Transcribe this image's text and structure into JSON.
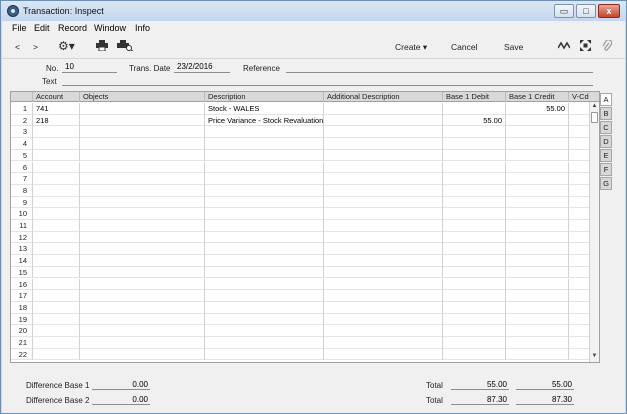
{
  "window": {
    "title": "Transaction: Inspect",
    "controls": {
      "minimize": "▭",
      "maximize": "□",
      "close": "x"
    }
  },
  "menu": [
    "File",
    "Edit",
    "Record",
    "Window",
    "Info"
  ],
  "toolbar": {
    "back": "<",
    "forward": ">",
    "create_label": "Create",
    "cancel_label": "Cancel",
    "save_label": "Save",
    "icons": [
      "gear-icon",
      "print-icon",
      "print-preview-icon",
      "activity-icon",
      "fullscreen-icon",
      "paperclip-icon"
    ]
  },
  "header": {
    "no_label": "No.",
    "no_value": "10",
    "trans_date_label": "Trans. Date",
    "trans_date_value": "23/2/2016",
    "reference_label": "Reference",
    "reference_value": "",
    "text_label": "Text",
    "text_value": ""
  },
  "grid": {
    "columns": [
      "Account",
      "Objects",
      "Description",
      "Additional Description",
      "Base 1 Debit",
      "Base 1 Credit",
      "V-Cd"
    ],
    "rows": [
      {
        "n": "1",
        "account": "741",
        "objects": "",
        "description": "Stock - WALES",
        "additional": "",
        "debit": "",
        "credit": "55.00",
        "vcd": ""
      },
      {
        "n": "2",
        "account": "218",
        "objects": "",
        "description": "Price Variance - Stock Revaluation",
        "additional": "",
        "debit": "55.00",
        "credit": "",
        "vcd": ""
      },
      {
        "n": "3"
      },
      {
        "n": "4"
      },
      {
        "n": "5"
      },
      {
        "n": "6"
      },
      {
        "n": "7"
      },
      {
        "n": "8"
      },
      {
        "n": "9"
      },
      {
        "n": "10"
      },
      {
        "n": "11"
      },
      {
        "n": "12"
      },
      {
        "n": "13"
      },
      {
        "n": "14"
      },
      {
        "n": "15"
      },
      {
        "n": "16"
      },
      {
        "n": "17"
      },
      {
        "n": "18"
      },
      {
        "n": "19"
      },
      {
        "n": "20"
      },
      {
        "n": "21"
      },
      {
        "n": "22"
      }
    ]
  },
  "side_tabs": [
    "A",
    "B",
    "C",
    "D",
    "E",
    "F",
    "G"
  ],
  "active_tab": "A",
  "footer": {
    "diff1_label": "Difference Base 1",
    "diff1_value": "0.00",
    "diff2_label": "Difference Base 2",
    "diff2_value": "0.00",
    "total_label": "Total",
    "total1_debit": "55.00",
    "total1_credit": "55.00",
    "total2_debit": "87.30",
    "total2_credit": "87.30"
  },
  "colors": {
    "title_bar": "#c4d7ee",
    "panel": "#f0f0f0",
    "grid_header": "#d9d9d9"
  }
}
